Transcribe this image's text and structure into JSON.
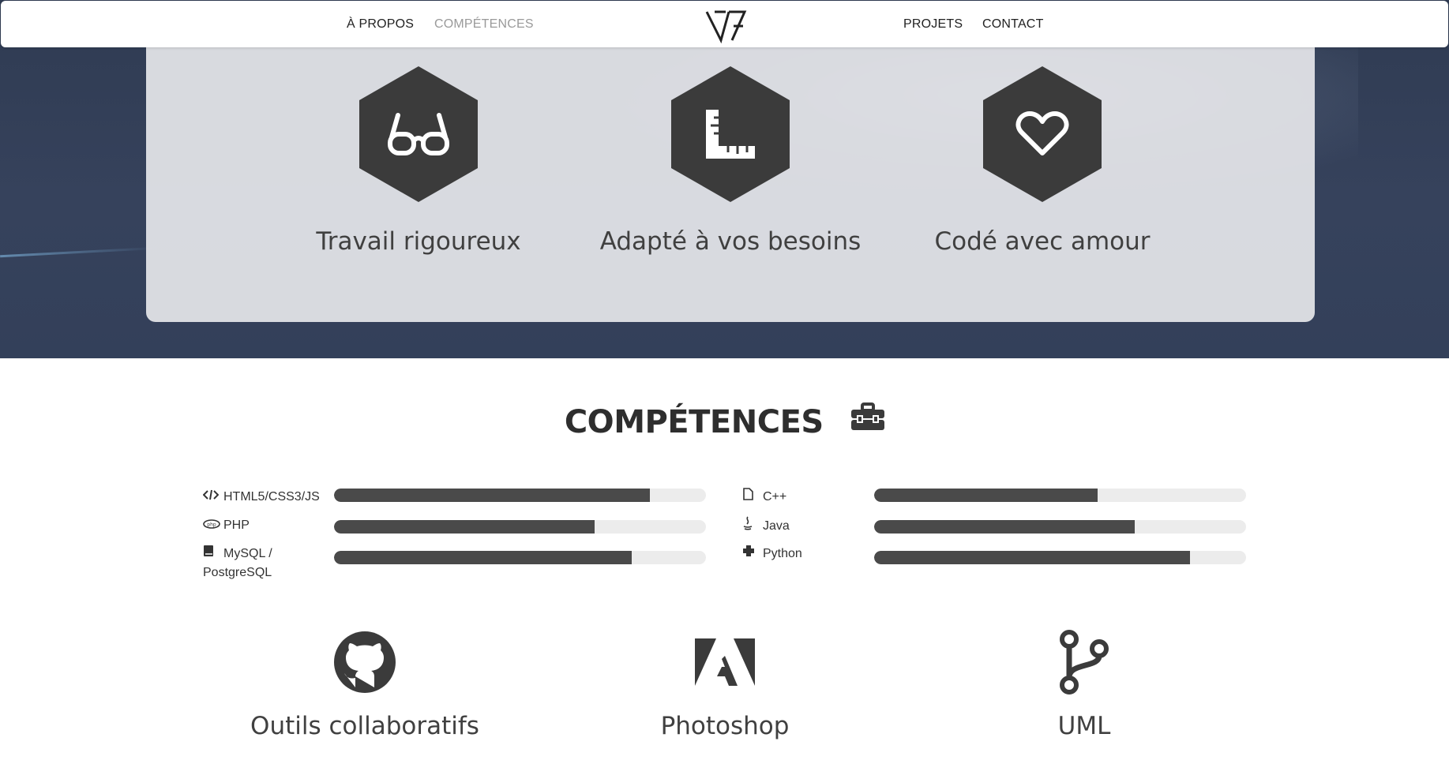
{
  "nav": {
    "left": [
      "À PROPOS",
      "COMPÉTENCES"
    ],
    "right": [
      "PROJETS",
      "CONTACT"
    ],
    "active": "COMPÉTENCES"
  },
  "features": [
    {
      "icon": "glasses-icon",
      "title": "Travail rigoureux"
    },
    {
      "icon": "ruler-square-icon",
      "title": "Adapté à vos besoins"
    },
    {
      "icon": "heart-icon",
      "title": "Codé avec amour"
    }
  ],
  "skills_section": {
    "title": "COMPÉTENCES",
    "icon": "toolbox-icon",
    "left": [
      {
        "icon": "code-icon",
        "label": "HTML5/CSS3/JS",
        "level": 0.85
      },
      {
        "icon": "php-icon",
        "label": "PHP",
        "level": 0.7
      },
      {
        "icon": "book-icon",
        "label": "MySQL / PostgreSQL",
        "level": 0.8
      }
    ],
    "right": [
      {
        "icon": "file-icon",
        "label": "C++",
        "level": 0.6
      },
      {
        "icon": "java-icon",
        "label": "Java",
        "level": 0.7
      },
      {
        "icon": "python-icon",
        "label": "Python",
        "level": 0.85
      }
    ]
  },
  "tools": [
    {
      "icon": "github-icon",
      "name": "Outils collaboratifs"
    },
    {
      "icon": "adobe-icon",
      "name": "Photoshop"
    },
    {
      "icon": "branch-icon",
      "name": "UML"
    }
  ],
  "colors": {
    "dark": "#3b3b3b",
    "bar_bg": "#ececec",
    "bar_fill": "#4a4a4a",
    "hero": "#33405a"
  }
}
